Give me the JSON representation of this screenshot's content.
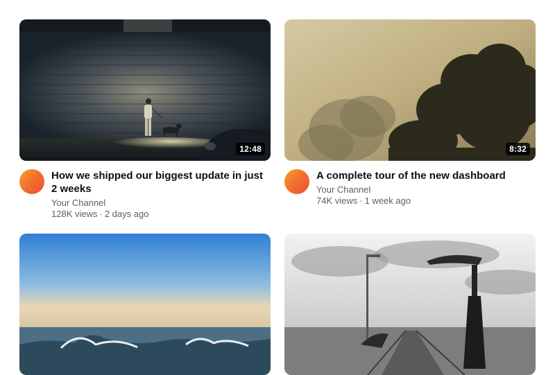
{
  "videos": [
    {
      "title": "How we shipped our biggest update in just 2 weeks",
      "channel": "Your Channel",
      "views": "128K views",
      "age": "2 days ago",
      "duration": "12:48",
      "thumbnail": "night-street-wall-figure"
    },
    {
      "title": "A complete tour of the new dashboard",
      "channel": "Your Channel",
      "views": "74K views",
      "age": "1 week ago",
      "duration": "8:32",
      "thumbnail": "foggy-trees-silhouette"
    },
    {
      "title": "",
      "channel": "",
      "views": "",
      "age": "",
      "duration": "",
      "thumbnail": "ocean-wave-blue-sky"
    },
    {
      "title": "",
      "channel": "",
      "views": "",
      "age": "",
      "duration": "",
      "thumbnail": "pier-lamp-grayscale"
    }
  ],
  "separator": "·",
  "colors": {
    "avatar_start": "#f5a02a",
    "avatar_end": "#ef4f3a",
    "title": "#0f0f0f",
    "secondary": "#606060",
    "duration_bg": "#000000"
  }
}
